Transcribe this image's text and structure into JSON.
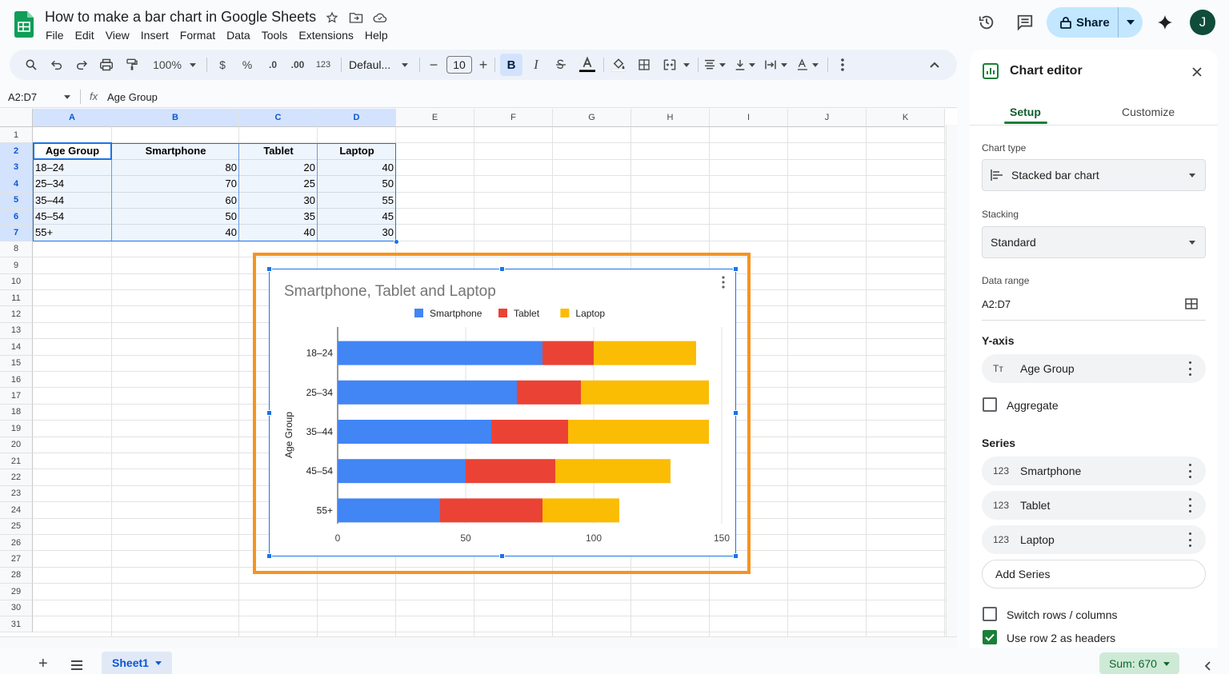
{
  "document": {
    "title": "How to make a bar chart in Google Sheets",
    "menu": [
      "File",
      "Edit",
      "View",
      "Insert",
      "Format",
      "Data",
      "Tools",
      "Extensions",
      "Help"
    ]
  },
  "header": {
    "share_label": "Share",
    "avatar_initial": "J"
  },
  "toolbar": {
    "zoom": "100%",
    "currency": "$",
    "percent": "%",
    "dec_decrease": ".0",
    "dec_increase": ".00",
    "number_format": "123",
    "font": "Defaul...",
    "font_size": "10",
    "bold": "B",
    "italic": "I"
  },
  "formula_bar": {
    "range": "A2:D7",
    "fx": "fx",
    "value": "Age Group"
  },
  "sheet": {
    "columns": [
      "A",
      "B",
      "C",
      "D",
      "E",
      "F",
      "G",
      "H",
      "I",
      "J",
      "K"
    ],
    "rows": [
      "1",
      "2",
      "3",
      "4",
      "5",
      "6",
      "7",
      "8",
      "9",
      "10",
      "11",
      "12",
      "13",
      "14",
      "15",
      "16",
      "17",
      "18",
      "19",
      "20",
      "21",
      "22",
      "23",
      "24",
      "25",
      "26",
      "27",
      "28",
      "29",
      "30",
      "31"
    ],
    "headers": [
      "Age Group",
      "Smartphone",
      "Tablet",
      "Laptop"
    ],
    "data": [
      [
        "18–24",
        "80",
        "20",
        "40"
      ],
      [
        "25–34",
        "70",
        "25",
        "50"
      ],
      [
        "35–44",
        "60",
        "30",
        "55"
      ],
      [
        "45–54",
        "50",
        "35",
        "45"
      ],
      [
        "55+",
        "40",
        "40",
        "30"
      ]
    ]
  },
  "chart_data": {
    "type": "bar",
    "orientation": "horizontal",
    "stacking": "standard",
    "title": "Smartphone, Tablet and Laptop",
    "ylabel": "Age Group",
    "xlabel": "",
    "categories": [
      "18–24",
      "25–34",
      "35–44",
      "45–54",
      "55+"
    ],
    "series": [
      {
        "name": "Smartphone",
        "color": "#4285f4",
        "values": [
          80,
          70,
          60,
          50,
          40
        ]
      },
      {
        "name": "Tablet",
        "color": "#ea4335",
        "values": [
          20,
          25,
          30,
          35,
          40
        ]
      },
      {
        "name": "Laptop",
        "color": "#fbbc04",
        "values": [
          40,
          50,
          55,
          45,
          30
        ]
      }
    ],
    "xlim": [
      0,
      150
    ],
    "xticks": [
      "0",
      "50",
      "100",
      "150"
    ],
    "legend": "top",
    "grid": true
  },
  "editor": {
    "title": "Chart editor",
    "tabs": {
      "setup": "Setup",
      "customize": "Customize"
    },
    "chart_type_label": "Chart type",
    "chart_type_value": "Stacked bar chart",
    "stacking_label": "Stacking",
    "stacking_value": "Standard",
    "data_range_label": "Data range",
    "data_range_value": "A2:D7",
    "y_axis_label": "Y-axis",
    "y_axis_value": "Age Group",
    "y_axis_icon": "Tт",
    "aggregate_label": "Aggregate",
    "series_label": "Series",
    "series_icon": "123",
    "series": [
      "Smartphone",
      "Tablet",
      "Laptop"
    ],
    "add_series": "Add Series",
    "switch_rows": "Switch rows / columns",
    "use_row_headers": "Use row 2 as headers"
  },
  "footer": {
    "sheet_tab": "Sheet1",
    "sum": "Sum: 670"
  }
}
